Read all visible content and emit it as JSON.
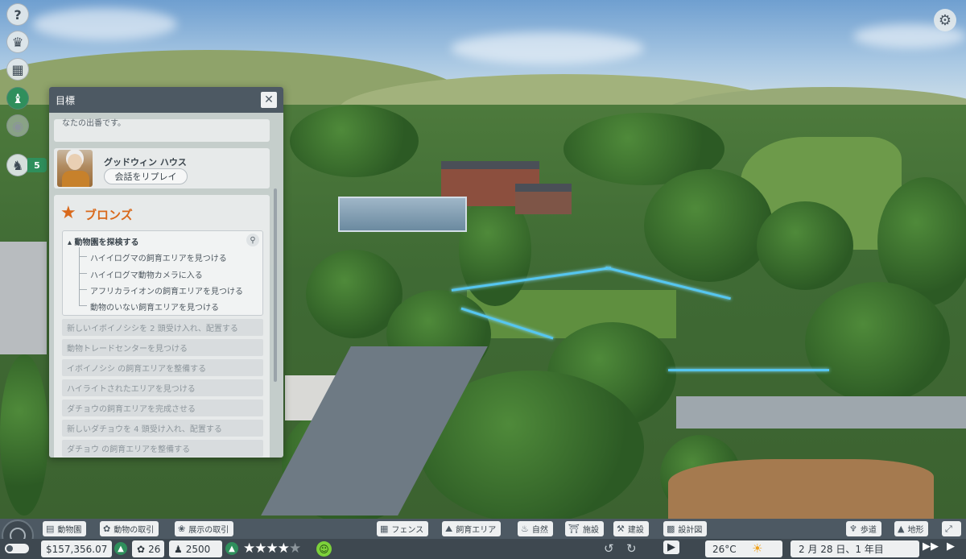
{
  "objectives": {
    "title": "目標",
    "cut_text": "なたの出番です。",
    "character": {
      "name": "グッドウィン ハウス",
      "replay_label": "会話をリプレイ"
    },
    "tier": {
      "title": "ブロンズ",
      "main_task": "動物園を探検する",
      "subtasks": [
        "ハイイログマの飼育エリアを見つける",
        "ハイイログマ動物カメラに入る",
        "アフリカライオンの飼育エリアを見つける",
        "動物のいない飼育エリアを見つける"
      ],
      "locked_tasks": [
        "新しいイボイノシシを 2 頭受け入れ、配置する",
        "動物トレードセンターを見つける",
        "イボイノシシ の飼育エリアを整備する",
        "ハイライトされたエリアを見つける",
        "ダチョウの飼育エリアを完成させる",
        "新しいダチョウを 4 頭受け入れ、配置する",
        "ダチョウ の飼育エリアを整備する"
      ]
    }
  },
  "side_menu": {
    "badge_count": "5"
  },
  "bottom_bar": {
    "left_buttons": [
      "動物園",
      "動物の取引",
      "展示の取引"
    ],
    "center_buttons": [
      "フェンス",
      "飼育エリア",
      "自然",
      "施設",
      "建設",
      "設計図"
    ],
    "right_buttons": [
      "歩道",
      "地形"
    ],
    "money": "$157,356.07",
    "research": "26",
    "guests": "2500",
    "rating_stars": 4,
    "rating_max": 5,
    "temperature": "26°C",
    "date": "2 月 28 日、1 年目"
  },
  "colors": {
    "panel_header": "#4d5963",
    "bronze": "#d9691c",
    "active_green": "#2f8f5c"
  },
  "icons": {
    "side": [
      "help-icon",
      "animal-icon",
      "calendar-icon",
      "trophy-icon",
      "eye-icon",
      "chess-knight-icon"
    ],
    "top_right": "gear-icon"
  }
}
